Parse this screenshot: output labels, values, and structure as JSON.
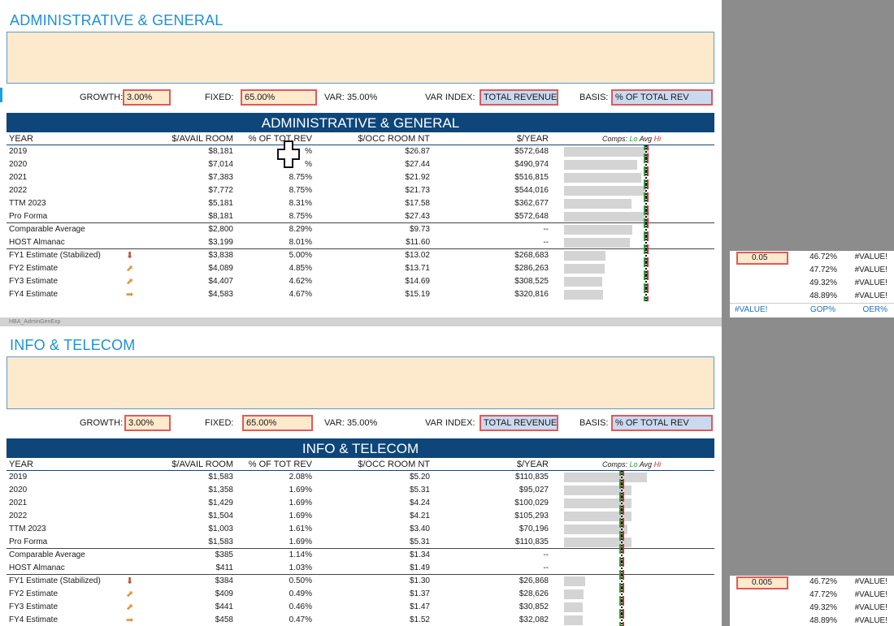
{
  "sections": [
    {
      "title": "ADMINISTRATIVE & GENERAL",
      "banner": "ADMINISTRATIVE & GENERAL",
      "inputs": {
        "growth_label": "GROWTH:",
        "growth_value": "3.00%",
        "fixed_label": "FIXED:",
        "fixed_value": "65.00%",
        "var_label": "VAR: 35.00%",
        "var_index_label": "VAR INDEX:",
        "var_index_value": "TOTAL REVENUE",
        "basis_label": "BASIS:",
        "basis_value": "% OF TOTAL REV"
      },
      "headers": {
        "year": "YEAR",
        "avail": "$/AVAIL ROOM",
        "pct": "% OF TOT REV",
        "occ": "$/OCC ROOM NT",
        "per_year": "$/YEAR",
        "comps": "Comps:",
        "lo": "Lo",
        "avg": "Avg",
        "hi": "Hi"
      },
      "rows": [
        {
          "name": "2019",
          "arrow": "",
          "avail": "$8,181",
          "pct": "%",
          "occ": "$26.87",
          "year": "$572,648",
          "bar": 0.7
        },
        {
          "name": "2020",
          "arrow": "",
          "avail": "$7,014",
          "pct": "%",
          "occ": "$27.44",
          "year": "$490,974",
          "bar": 0.6
        },
        {
          "name": "2021",
          "arrow": "",
          "avail": "$7,383",
          "pct": "8.75%",
          "occ": "$21.92",
          "year": "$516,815",
          "bar": 0.63
        },
        {
          "name": "2022",
          "arrow": "",
          "avail": "$7,772",
          "pct": "8.75%",
          "occ": "$21.73",
          "year": "$544,016",
          "bar": 0.67
        },
        {
          "name": "TTM 2023",
          "arrow": "",
          "avail": "$5,181",
          "pct": "8.31%",
          "occ": "$17.58",
          "year": "$362,677",
          "bar": 0.55
        },
        {
          "name": "Pro Forma",
          "arrow": "",
          "avail": "$8,181",
          "pct": "8.75%",
          "occ": "$27.43",
          "year": "$572,648",
          "bar": 0.7
        },
        {
          "name": "Comparable Average",
          "arrow": "",
          "avail": "$2,800",
          "pct": "8.29%",
          "occ": "$9.73",
          "year": "--",
          "bar": 0.56
        },
        {
          "name": "HOST Almanac",
          "arrow": "",
          "avail": "$3,199",
          "pct": "8.01%",
          "occ": "$11.60",
          "year": "--",
          "bar": 0.54
        },
        {
          "name": "FY1 Estimate (Stabilized)",
          "arrow": "down",
          "avail": "$3,838",
          "pct": "5.00%",
          "occ": "$13.02",
          "year": "$268,683",
          "bar": 0.34
        },
        {
          "name": "FY2 Estimate",
          "arrow": "side",
          "avail": "$4,089",
          "pct": "4.85%",
          "occ": "$13.71",
          "year": "$286,263",
          "bar": 0.33
        },
        {
          "name": "FY3 Estimate",
          "arrow": "side",
          "avail": "$4,407",
          "pct": "4.62%",
          "occ": "$14.69",
          "year": "$308,525",
          "bar": 0.31
        },
        {
          "name": "FY4 Estimate",
          "arrow": "right",
          "avail": "$4,583",
          "pct": "4.67%",
          "occ": "$15.19",
          "year": "$320,816",
          "bar": 0.32
        }
      ]
    },
    {
      "title": "INFO & TELECOM",
      "banner": "INFO & TELECOM",
      "inputs": {
        "growth_label": "GROWTH:",
        "growth_value": "3.00%",
        "fixed_label": "FIXED:",
        "fixed_value": "65.00%",
        "var_label": "VAR: 35.00%",
        "var_index_label": "VAR INDEX:",
        "var_index_value": "TOTAL REVENUE",
        "basis_label": "BASIS:",
        "basis_value": "% OF TOTAL REV"
      },
      "headers": {
        "year": "YEAR",
        "avail": "$/AVAIL ROOM",
        "pct": "% OF TOT REV",
        "occ": "$/OCC ROOM NT",
        "per_year": "$/YEAR",
        "comps": "Comps:",
        "lo": "Lo",
        "avg": "Avg",
        "hi": "Hi"
      },
      "rows": [
        {
          "name": "2019",
          "arrow": "",
          "avail": "$1,583",
          "pct": "2.08%",
          "occ": "$5.20",
          "year": "$110,835",
          "bar": 0.68
        },
        {
          "name": "2020",
          "arrow": "",
          "avail": "$1,358",
          "pct": "1.69%",
          "occ": "$5.31",
          "year": "$95,027",
          "bar": 0.55
        },
        {
          "name": "2021",
          "arrow": "",
          "avail": "$1,429",
          "pct": "1.69%",
          "occ": "$4.24",
          "year": "$100,029",
          "bar": 0.55
        },
        {
          "name": "2022",
          "arrow": "",
          "avail": "$1,504",
          "pct": "1.69%",
          "occ": "$4.21",
          "year": "$105,293",
          "bar": 0.55
        },
        {
          "name": "TTM 2023",
          "arrow": "",
          "avail": "$1,003",
          "pct": "1.61%",
          "occ": "$3.40",
          "year": "$70,196",
          "bar": 0.52
        },
        {
          "name": "Pro Forma",
          "arrow": "",
          "avail": "$1,583",
          "pct": "1.69%",
          "occ": "$5.31",
          "year": "$110,835",
          "bar": 0.55
        },
        {
          "name": "Comparable Average",
          "arrow": "",
          "avail": "$385",
          "pct": "1.14%",
          "occ": "$1.34",
          "year": "--",
          "bar": 0.0
        },
        {
          "name": "HOST Almanac",
          "arrow": "",
          "avail": "$411",
          "pct": "1.03%",
          "occ": "$1.49",
          "year": "--",
          "bar": 0.0
        },
        {
          "name": "FY1 Estimate (Stabilized)",
          "arrow": "down",
          "avail": "$384",
          "pct": "0.50%",
          "occ": "$1.30",
          "year": "$26,868",
          "bar": 0.17
        },
        {
          "name": "FY2 Estimate",
          "arrow": "side",
          "avail": "$409",
          "pct": "0.49%",
          "occ": "$1.37",
          "year": "$28,626",
          "bar": 0.16
        },
        {
          "name": "FY3 Estimate",
          "arrow": "side",
          "avail": "$441",
          "pct": "0.46%",
          "occ": "$1.47",
          "year": "$30,852",
          "bar": 0.15
        },
        {
          "name": "FY4 Estimate",
          "arrow": "right",
          "avail": "$458",
          "pct": "0.47%",
          "occ": "$1.52",
          "year": "$32,082",
          "bar": 0.15
        }
      ]
    }
  ],
  "tab_label": "HBA_AdminGenExp",
  "side_a": {
    "input_value": "0.05",
    "rows": [
      {
        "gop": "46.72%",
        "oer": "#VALUE!"
      },
      {
        "gop": "47.72%",
        "oer": "#VALUE!"
      },
      {
        "gop": "49.32%",
        "oer": "#VALUE!"
      },
      {
        "gop": "48.89%",
        "oer": "#VALUE!"
      }
    ],
    "footer": {
      "c1": "#VALUE!",
      "c2": "GOP%",
      "c3": "OER%"
    }
  },
  "side_b": {
    "input_value": "0.005",
    "rows": [
      {
        "gop": "46.72%",
        "oer": "#VALUE!"
      },
      {
        "gop": "47.72%",
        "oer": "#VALUE!"
      },
      {
        "gop": "49.32%",
        "oer": "#VALUE!"
      },
      {
        "gop": "48.89%",
        "oer": "#VALUE!"
      }
    ]
  },
  "colors": {
    "accent": "#1e90d6",
    "banner": "#0e4679",
    "notes_bg": "#fde9cc",
    "highlight": "#e05a5a"
  }
}
